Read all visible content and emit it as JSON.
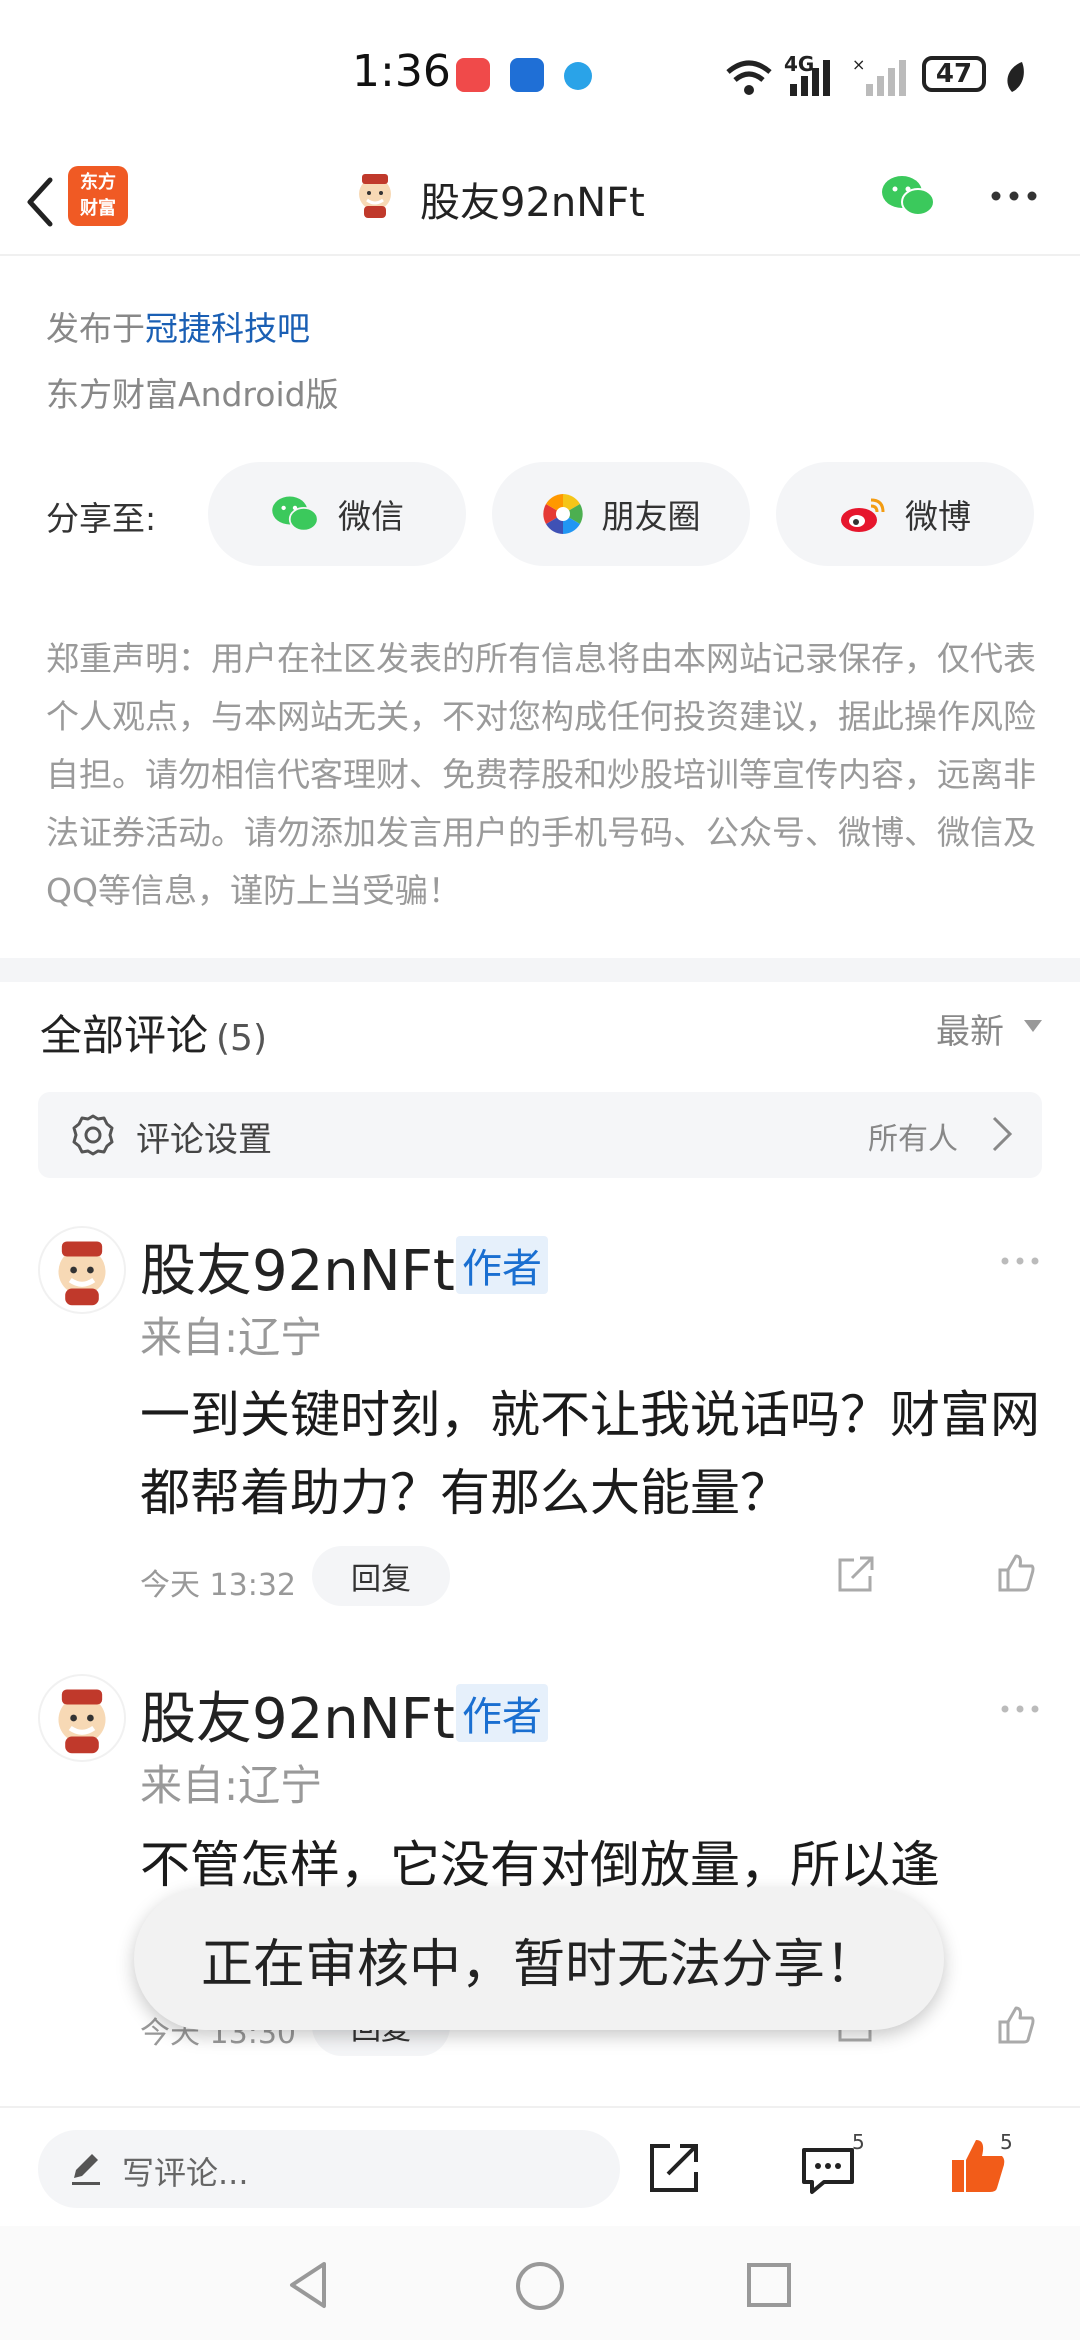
{
  "status_bar": {
    "time": "1:36",
    "network": "4G",
    "battery": "47"
  },
  "header": {
    "brand_logo": "东方\n财富",
    "title": "股友92nNFt"
  },
  "post": {
    "published_prefix": "发布于",
    "forum": "冠捷科技吧",
    "client": "东方财富Android版"
  },
  "share": {
    "label": "分享至:",
    "options": [
      {
        "label": "微信",
        "icon": "wechat-icon"
      },
      {
        "label": "朋友圈",
        "icon": "moments-icon"
      },
      {
        "label": "微博",
        "icon": "weibo-icon"
      }
    ]
  },
  "disclaimer": "郑重声明：用户在社区发表的所有信息将由本网站记录保存，仅代表个人观点，与本网站无关，不对您构成任何投资建议，据此操作风险自担。请勿相信代客理财、免费荐股和炒股培训等宣传内容，远离非法证券活动。请勿添加发言用户的手机号码、公众号、微博、微信及QQ等信息，谨防上当受骗！",
  "comments_section": {
    "title": "全部评论",
    "count": "(5)",
    "sort": "最新",
    "settings_label": "评论设置",
    "settings_value": "所有人"
  },
  "comments": [
    {
      "user": "股友92nNFt",
      "badge": "作者",
      "location": "来自:辽宁",
      "text": "一到关键时刻，就不让我说话吗？财富网都帮着助力？有那么大能量？",
      "time": "今天 13:32",
      "reply": "回复"
    },
    {
      "user": "股友92nNFt",
      "badge": "作者",
      "location": "来自:辽宁",
      "text": "不管怎样，它没有对倒放量，所以逢",
      "time": "今天 13:30",
      "reply": "回复"
    }
  ],
  "toast": "正在审核中，暂时无法分享！",
  "bottom_bar": {
    "input_placeholder": "写评论...",
    "comment_count": "5",
    "like_count": "5"
  },
  "colors": {
    "accent_blue": "#1a5fb4",
    "brand_orange": "#f05a24",
    "like_orange": "#f25c19"
  }
}
